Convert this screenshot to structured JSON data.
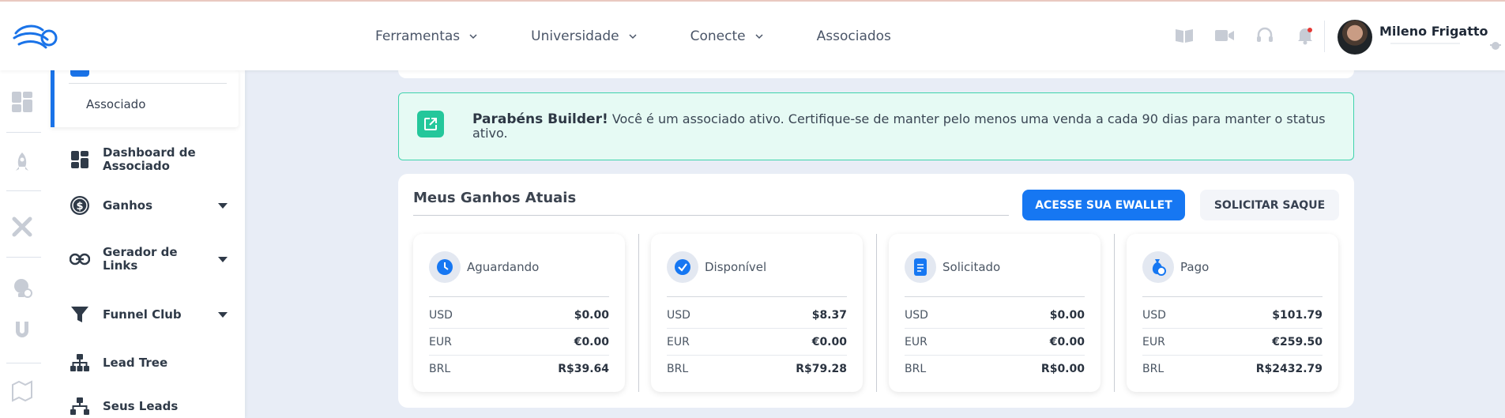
{
  "header": {
    "nav": [
      {
        "label": "Ferramentas",
        "dropdown": true
      },
      {
        "label": "Universidade",
        "dropdown": true
      },
      {
        "label": "Conecte",
        "dropdown": true
      },
      {
        "label": "Associados",
        "dropdown": false
      }
    ],
    "icons": [
      "book-icon",
      "video-icon",
      "headset-icon",
      "bell-icon"
    ],
    "user_name": "Mileno Frigatto"
  },
  "sidebar": {
    "current_section": "Associado",
    "items": [
      {
        "label": "Dashboard de Associado",
        "icon": "dashboard-icon",
        "expandable": false
      },
      {
        "label": "Ganhos",
        "icon": "dollar-icon",
        "expandable": true
      },
      {
        "label": "Gerador de Links",
        "icon": "link-icon",
        "expandable": true
      },
      {
        "label": "Funnel Club",
        "icon": "funnel-icon",
        "expandable": true
      },
      {
        "label": "Lead Tree",
        "icon": "tree-icon",
        "expandable": false
      },
      {
        "label": "Seus Leads",
        "icon": "leads-icon",
        "expandable": false
      }
    ]
  },
  "alert": {
    "title": "Parabéns Builder!",
    "message": "Você é um associado ativo. Certifique-se de manter pelo menos uma venda a cada 90 dias para manter o status ativo."
  },
  "earnings": {
    "title": "Meus Ganhos Atuais",
    "wallet_button": "ACESSE SUA EWALLET",
    "withdraw_button": "SOLICITAR SAQUE",
    "cards": [
      {
        "label": "Aguardando",
        "icon": "clock-icon",
        "rows": [
          {
            "currency": "USD",
            "value": "$0.00"
          },
          {
            "currency": "EUR",
            "value": "€0.00"
          },
          {
            "currency": "BRL",
            "value": "R$39.64"
          }
        ]
      },
      {
        "label": "Disponível",
        "icon": "check-icon",
        "rows": [
          {
            "currency": "USD",
            "value": "$8.37"
          },
          {
            "currency": "EUR",
            "value": "€0.00"
          },
          {
            "currency": "BRL",
            "value": "R$79.28"
          }
        ]
      },
      {
        "label": "Solicitado",
        "icon": "document-icon",
        "rows": [
          {
            "currency": "USD",
            "value": "$0.00"
          },
          {
            "currency": "EUR",
            "value": "€0.00"
          },
          {
            "currency": "BRL",
            "value": "R$0.00"
          }
        ]
      },
      {
        "label": "Pago",
        "icon": "money-bag-icon",
        "rows": [
          {
            "currency": "USD",
            "value": "$101.79"
          },
          {
            "currency": "EUR",
            "value": "€259.50"
          },
          {
            "currency": "BRL",
            "value": "R$2432.79"
          }
        ]
      }
    ]
  },
  "colors": {
    "primary": "#1677f2",
    "success": "#24c79b",
    "alert_bg": "#e6faf4",
    "page_bg": "#e8edf6"
  }
}
